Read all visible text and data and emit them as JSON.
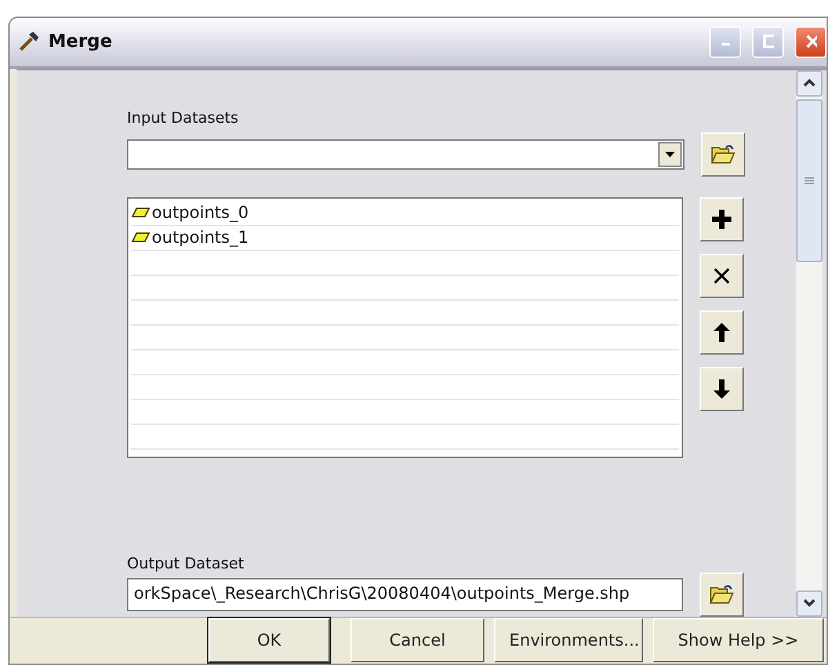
{
  "window": {
    "title": "Merge"
  },
  "input_datasets": {
    "label": "Input Datasets"
  },
  "dataset_list": {
    "items": [
      {
        "name": "outpoints_0"
      },
      {
        "name": "outpoints_1"
      }
    ]
  },
  "output_dataset": {
    "label": "Output Dataset",
    "value": "orkSpace\\_Research\\ChrisG\\20080404\\outpoints_Merge.shp"
  },
  "buttons": [
    {
      "label": "OK",
      "default": true
    },
    {
      "label": "Cancel",
      "default": false
    },
    {
      "label": "Environments...",
      "default": false
    },
    {
      "label": "Show Help >>",
      "default": false
    }
  ]
}
